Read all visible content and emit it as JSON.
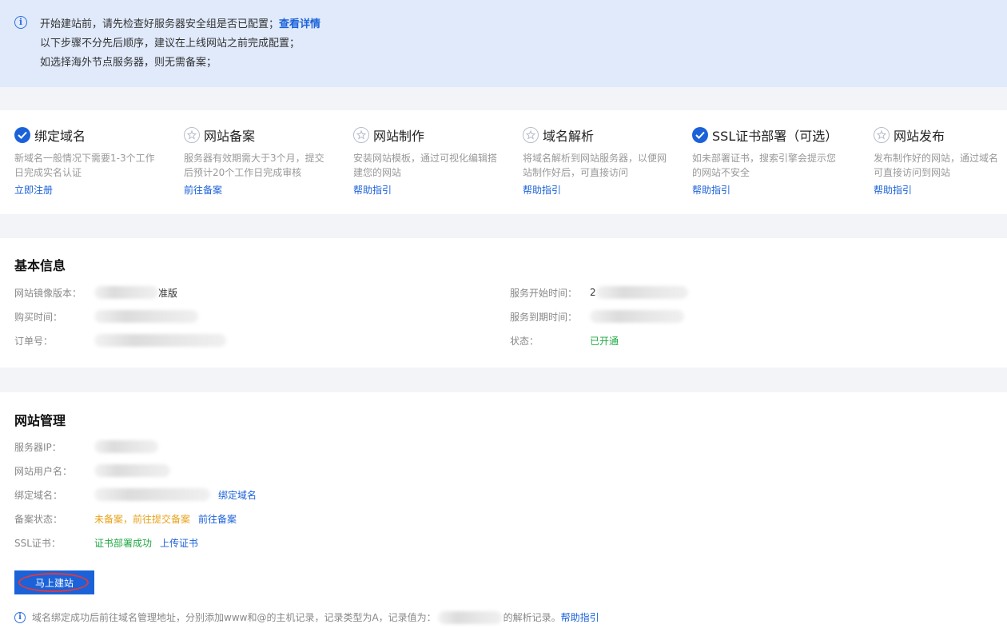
{
  "alert": {
    "lines": [
      "开始建站前，请先检查好服务器安全组是否已配置；",
      "以下步骤不分先后顺序，建议在上线网站之前完成配置；",
      "如选择海外节点服务器，则无需备案；"
    ],
    "link": "查看详情"
  },
  "steps": [
    {
      "title": "绑定域名",
      "status": "done",
      "desc": "新域名一般情况下需要1-3个工作日完成实名认证",
      "link": "立即注册"
    },
    {
      "title": "网站备案",
      "status": "todo",
      "desc": "服务器有效期需大于3个月，提交后预计20个工作日完成审核",
      "link": "前往备案"
    },
    {
      "title": "网站制作",
      "status": "todo",
      "desc": "安装网站模板，通过可视化编辑搭建您的网站",
      "link": "帮助指引"
    },
    {
      "title": "域名解析",
      "status": "todo",
      "desc": "将域名解析到网站服务器，以便网站制作好后，可直接访问",
      "link": "帮助指引"
    },
    {
      "title": "SSL证书部署（可选）",
      "status": "done",
      "desc": "如未部署证书，搜索引擎会提示您的网站不安全",
      "link": "帮助指引"
    },
    {
      "title": "网站发布",
      "status": "todo",
      "desc": "发布制作好的网站，通过域名可直接访问到网站",
      "link": "帮助指引"
    }
  ],
  "basic": {
    "title": "基本信息",
    "image_version_label": "网站镜像版本：",
    "image_version_tail": "准版",
    "purchase_time_label": "购买时间：",
    "order_no_label": "订单号：",
    "service_start_label": "服务开始时间：",
    "service_start_head": "2",
    "service_end_label": "服务到期时间：",
    "status_label": "状态：",
    "status_value": "已开通"
  },
  "manage": {
    "title": "网站管理",
    "server_ip_label": "服务器IP：",
    "site_user_label": "网站用户名：",
    "bound_domain_label": "绑定域名：",
    "bind_domain_link": "绑定域名",
    "icp_label": "备案状态：",
    "icp_value": "未备案，前往提交备案",
    "icp_link": "前往备案",
    "ssl_label": "SSL证书：",
    "ssl_value": "证书部署成功",
    "ssl_link": "上传证书",
    "build_button": "马上建站",
    "tip_text_before": "域名绑定成功后前往域名管理地址，分别添加www和@的主机记录，记录类型为A，记录值为：",
    "tip_text_after": "的解析记录。",
    "tip_link": "帮助指引"
  },
  "colors": {
    "accent": "#1b62d9",
    "success": "#22a844",
    "warning": "#e8a21c",
    "alert_bg": "#e0eafb"
  }
}
